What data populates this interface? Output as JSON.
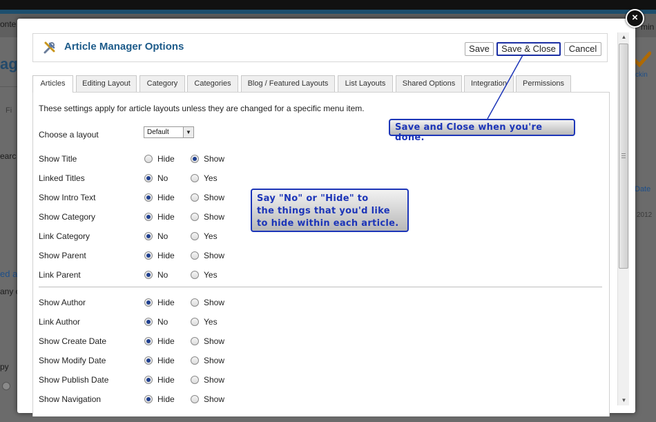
{
  "background": {
    "fragments": {
      "content": "onte",
      "admin": "min",
      "title": "ag",
      "filter": "Fi",
      "search": "earc",
      "date": "Date",
      "datevalue": "2012",
      "linked": "ed a",
      "any": "any c",
      "py": "py",
      "checkin": "ckin"
    }
  },
  "close_icon": "×",
  "header": {
    "title": "Article Manager Options",
    "save_label": "Save",
    "save_close_label": "Save & Close",
    "cancel_label": "Cancel"
  },
  "tabs": [
    {
      "label": "Articles",
      "active": true
    },
    {
      "label": "Editing Layout"
    },
    {
      "label": "Category"
    },
    {
      "label": "Categories"
    },
    {
      "label": "Blog / Featured Layouts"
    },
    {
      "label": "List Layouts"
    },
    {
      "label": "Shared Options"
    },
    {
      "label": "Integration"
    },
    {
      "label": "Permissions"
    }
  ],
  "articles": {
    "intro": "These settings apply for article layouts unless they are changed for a specific menu item.",
    "layout_label": "Choose a layout",
    "layout_value": "Default",
    "rows": [
      {
        "label": "Show Title",
        "opt1": "Hide",
        "opt2": "Show",
        "selected": 2
      },
      {
        "label": "Linked Titles",
        "opt1": "No",
        "opt2": "Yes",
        "selected": 1
      },
      {
        "label": "Show Intro Text",
        "opt1": "Hide",
        "opt2": "Show",
        "selected": 1
      },
      {
        "label": "Show Category",
        "opt1": "Hide",
        "opt2": "Show",
        "selected": 1
      },
      {
        "label": "Link Category",
        "opt1": "No",
        "opt2": "Yes",
        "selected": 1
      },
      {
        "label": "Show Parent",
        "opt1": "Hide",
        "opt2": "Show",
        "selected": 1
      },
      {
        "label": "Link Parent",
        "opt1": "No",
        "opt2": "Yes",
        "selected": 1
      },
      {
        "label": "Show Author",
        "opt1": "Hide",
        "opt2": "Show",
        "selected": 1
      },
      {
        "label": "Link Author",
        "opt1": "No",
        "opt2": "Yes",
        "selected": 1
      },
      {
        "label": "Show Create Date",
        "opt1": "Hide",
        "opt2": "Show",
        "selected": 1
      },
      {
        "label": "Show Modify Date",
        "opt1": "Hide",
        "opt2": "Show",
        "selected": 1
      },
      {
        "label": "Show Publish Date",
        "opt1": "Hide",
        "opt2": "Show",
        "selected": 1
      },
      {
        "label": "Show Navigation",
        "opt1": "Hide",
        "opt2": "Show",
        "selected": 1
      }
    ]
  },
  "callouts": {
    "save_close": "Save and Close when you're done.",
    "hide_line1": "Say \"No\" or \"Hide\" to",
    "hide_line2": "the things that you'd like",
    "hide_line3": "to hide within each article."
  },
  "colors": {
    "accent": "#1d5b8a",
    "callout": "#1c35b8"
  }
}
